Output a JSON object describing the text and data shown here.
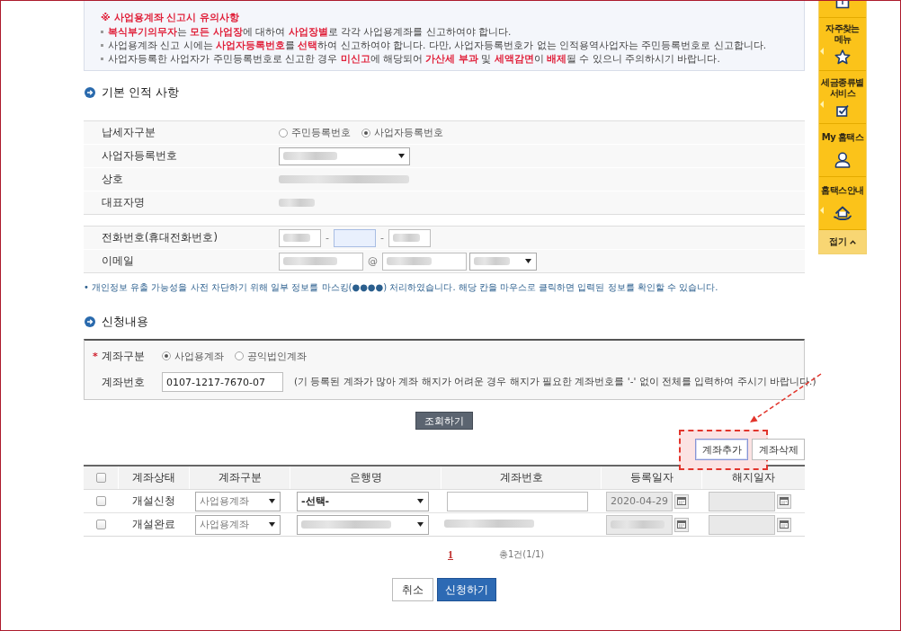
{
  "notice": {
    "title": "※ 사업용계좌 신고시 유의사항",
    "items": [
      "**복식부기의무자**는 **모든 사업장**에 대하여 **사업장별**로 각각 사업용계좌를 신고하여야 합니다.",
      "사업용계좌 신고 시에는 **사업자등록번호**를 **선택**하여 신고하여야 합니다. 다만, 사업자등록번호가 없는 인적용역사업자는 주민등록번호로 신고합니다.",
      "사업자등록한 사업자가 주민등록번호로 신고한 경우 **미신고**에 해당되어 **가산세 부과** 및 **세액감면**이 **배제**될 수 있으니 주의하시기 바랍니다."
    ]
  },
  "basic_info": {
    "heading": "기본 인적 사항",
    "groups": [
      {
        "rows": [
          {
            "kind": "radio",
            "label": "납세자구분",
            "options": [
              {
                "label": "주민등록번호",
                "selected": false
              },
              {
                "label": "사업자등록번호",
                "selected": true
              }
            ]
          },
          {
            "kind": "select",
            "label": "사업자등록번호",
            "blurred": true
          },
          {
            "kind": "text",
            "label": "상호",
            "blurred": true
          },
          {
            "kind": "text",
            "label": "대표자명",
            "blurred": true
          }
        ]
      },
      {
        "rows": [
          {
            "kind": "phone",
            "label": "전화번호(휴대전화번호)",
            "separators": [
              "-",
              "-"
            ],
            "parts": [
              {
                "blurred": true,
                "focused": false
              },
              {
                "blurred": false,
                "focused": true
              },
              {
                "blurred": true,
                "focused": false
              }
            ]
          },
          {
            "kind": "email",
            "label": "이메일",
            "separator": "@",
            "local": {
              "blurred": true
            },
            "domain": {
              "blurred": true
            },
            "domain_select": {
              "blurred": true
            }
          }
        ]
      }
    ],
    "note": "• 개인정보 유출 가능성을 사전 차단하기 위해 일부 정보를 마스킹(●●●●) 처리하였습니다. 해당 칸을 마우스로 클릭하면 입력된 정보를 확인할 수 있습니다."
  },
  "application": {
    "heading": "신청내용",
    "account_type": {
      "mark": "*",
      "label": "계좌구분",
      "options": [
        {
          "label": "사업용계좌",
          "selected": true
        },
        {
          "label": "공익법인계좌",
          "selected": false
        }
      ]
    },
    "account_number": {
      "label": "계좌번호",
      "value": "0107-1217-7670-07",
      "hint": "(기 등록된 계좌가 많아 계좌 해지가 어려운 경우 해지가 필요한 계좌번호를 '-' 없이 전체를 입력하여 주시기 바랍니다.)"
    },
    "search_button": "조회하기"
  },
  "accounts": {
    "toolbar": [
      {
        "label": "계좌추가",
        "highlighted": true,
        "focused": true
      },
      {
        "label": "계좌삭제",
        "highlighted": false,
        "focused": false
      }
    ],
    "header_checked": false,
    "columns": [
      "계좌상태",
      "계좌구분",
      "은행명",
      "계좌번호",
      "등록일자",
      "해지일자"
    ],
    "rows": [
      {
        "checked": false,
        "status": "개설신청",
        "type": "사업용계좌",
        "bank": {
          "value": "-선택-",
          "blurred": false
        },
        "account_number": {
          "kind": "input"
        },
        "reg_date": {
          "value": "2020-04-29",
          "blurred": false,
          "disabled": true
        },
        "cancel_date": {
          "disabled": true
        }
      },
      {
        "checked": false,
        "status": "개설완료",
        "type": "사업용계좌",
        "bank": {
          "blurred": true
        },
        "account_number": {
          "kind": "text",
          "blurred": true
        },
        "reg_date": {
          "blurred": true,
          "disabled": true
        },
        "cancel_date": {
          "disabled": true
        }
      }
    ]
  },
  "pagination": {
    "pages": [
      {
        "label": "1",
        "selected": true
      }
    ],
    "summary": "총1건(1/1)"
  },
  "actions": [
    {
      "label": "취소",
      "kind": "secondary"
    },
    {
      "label": "신청하기",
      "kind": "primary"
    }
  ],
  "sidebar": {
    "items": [
      {
        "lines": [
          "자주찾는",
          "메뉴"
        ],
        "has_flyout": true
      },
      {
        "lines": [
          "세금종류별",
          "서비스"
        ],
        "has_flyout": true
      },
      {
        "lines": [
          "My 홈택스"
        ],
        "has_flyout": false
      },
      {
        "lines": [
          "홈택스안내"
        ],
        "has_flyout": true
      }
    ],
    "collapse": "접기"
  }
}
